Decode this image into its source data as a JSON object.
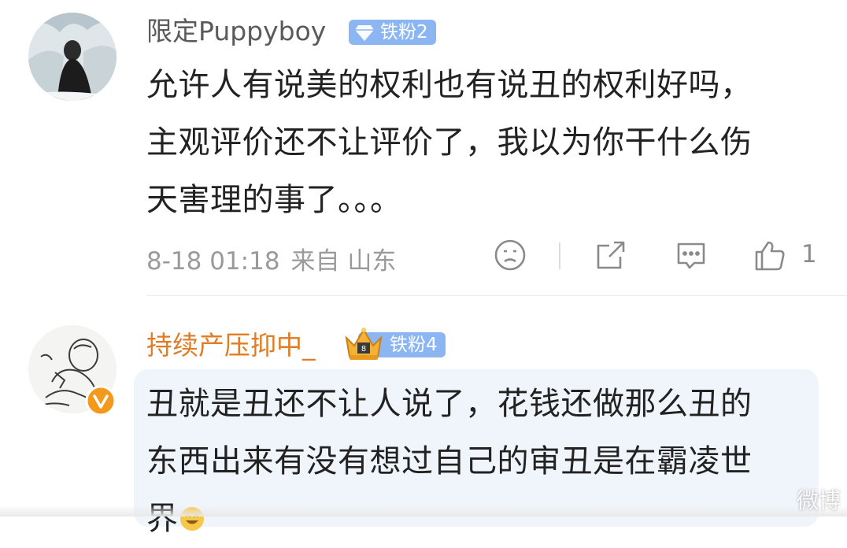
{
  "comments": [
    {
      "username": "限定Puppyboy",
      "badge": "铁粉2",
      "lines": [
        "允许人有说美的权利也有说丑的权利好吗，",
        "主观评价还不让评价了，我以为你干什么伤",
        "天害理的事了。。。"
      ],
      "time": "8-18 01:18",
      "location": "来自 山东",
      "likes": "1",
      "icons": {
        "dislike": "sad-face-icon",
        "repost": "share-icon",
        "comment": "comment-bubble-icon",
        "like": "thumbs-up-icon"
      }
    },
    {
      "username": "持续产压抑中_",
      "badge": "铁粉4",
      "lines": [
        "丑就是丑还不让人说了，花钱还做那么丑的",
        "东西出来有没有想过自己的审丑是在霸凌世",
        "界"
      ],
      "verified_icon": "verified-v-icon",
      "badge_icon": "crown-icon"
    }
  ],
  "colors": {
    "badge": "#8cb6f2",
    "username_highlight": "#e07c23",
    "meta": "#9a9a9a",
    "bubble": "#f0f5fb"
  },
  "watermark": "微博"
}
